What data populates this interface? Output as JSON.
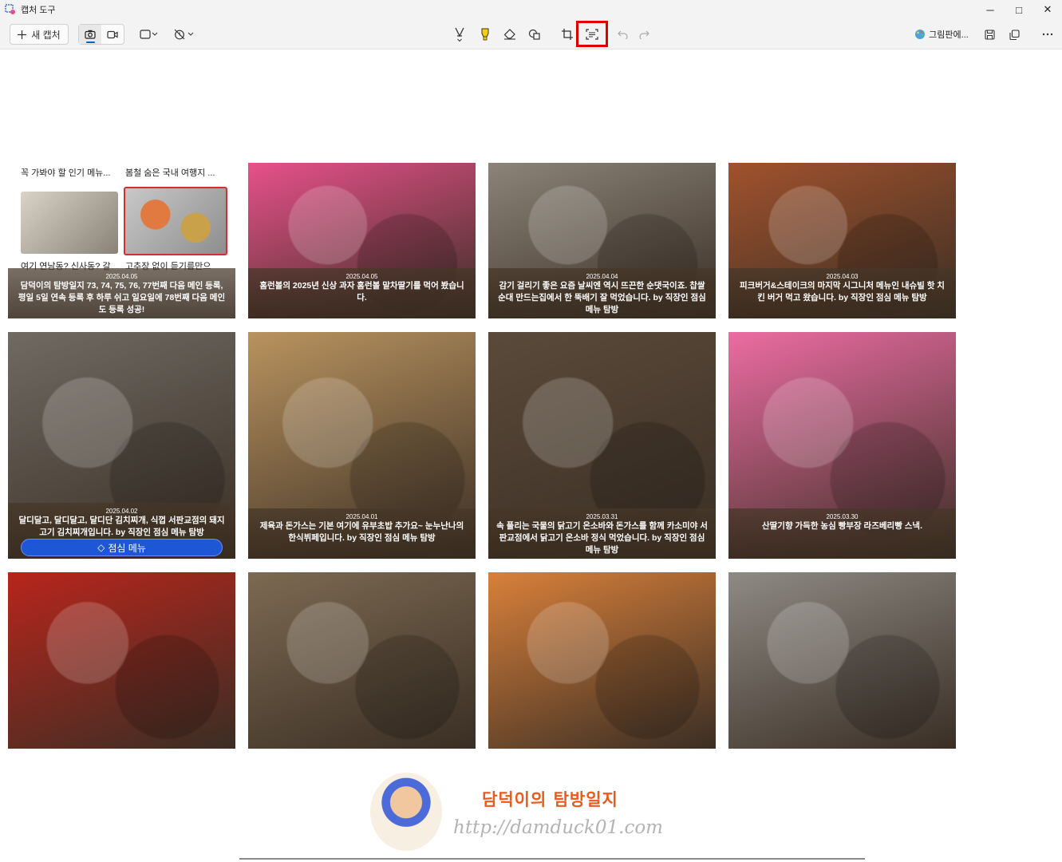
{
  "app": {
    "title": "캡처 도구",
    "new_capture_label": "새 캡처",
    "paint_label": "그림판에...",
    "window_buttons": [
      "─",
      "□",
      "✕"
    ]
  },
  "snippet": {
    "top_left_1": "꼭 가봐야 할 인기 메뉴...",
    "top_left_2": "봄철 숨은 국내 여행지 ...",
    "bottom_left_1": "여기 연남동? 신사동? 갈",
    "bottom_left_2": "고추장 없이 듣기름만으"
  },
  "tiles": [
    {
      "date": "2025.04.05",
      "text": "담덕이의 탐방일지 73, 74, 75, 76, 77번째 다음 메인 등록, 평일 5일 연속 등록 후 하루 쉬고 일요일에 78번째 다음 메인도 등록 성공!",
      "bg": "#c8c4bc"
    },
    {
      "date": "2025.04.05",
      "text": "홈런볼의 2025년 신상 과자 홈런볼 말차딸기를 먹어 봤습니다.",
      "bg": "#e7518a"
    },
    {
      "date": "2025.04.04",
      "text": "감기 걸리기 좋은 요즘 날씨엔 역시 뜨끈한 순댓국이죠. 찹쌀순대 만드는집에서 한 뚝배기 잘 먹었습니다. by 직장인 점심 메뉴 탐방",
      "bg": "#8c8478"
    },
    {
      "date": "2025.04.03",
      "text": "피크버거&스테이크의 마지막 시그니처 메뉴인 내슈빌 핫 치킨 버거 먹고 왔습니다. by 직장인 점심 메뉴 탐방",
      "bg": "#a0522d"
    },
    {
      "date": "2025.04.02",
      "text": "달디달고, 달디달고, 달디단 김치찌개, 식껍 서판교점의 돼지고기 김치찌개입니다. by 직장인 점심 메뉴 탐방",
      "bg": "#6f6a62",
      "tag": "점심 메뉴"
    },
    {
      "date": "2025.04.01",
      "text": "제육과 돈가스는 기본 여기에 유부초밥 추가요~ 눈누난나의 한식뷔페입니다. by 직장인 점심 메뉴 탐방",
      "bg": "#b9935f"
    },
    {
      "date": "2025.03.31",
      "text": "속 풀리는 국물의 닭고기 온소바와 돈가스를 함께 카소미야 서판교점에서 닭고기 온소바 정식 먹었습니다. by 직장인 점심 메뉴 탐방",
      "bg": "#5a4a3a"
    },
    {
      "date": "2025.03.30",
      "text": "산딸기향 가득한 농심 빵부장 라즈베리빵 스낵.",
      "bg": "#ec6ca2"
    },
    {
      "date": "",
      "text": "",
      "bg": "#b8251c"
    },
    {
      "date": "",
      "text": "",
      "bg": "#7c6a52"
    },
    {
      "date": "",
      "text": "",
      "bg": "#d9803a"
    },
    {
      "date": "",
      "text": "",
      "bg": "#8e8a84"
    }
  ],
  "footer": {
    "blog_name": "담덕이의 탐방일지",
    "blog_url": "http://damduck01.com"
  },
  "colors": {
    "highlight": "#e00000",
    "accent": "#0067c0",
    "tag_blue": "#1e57d6"
  }
}
